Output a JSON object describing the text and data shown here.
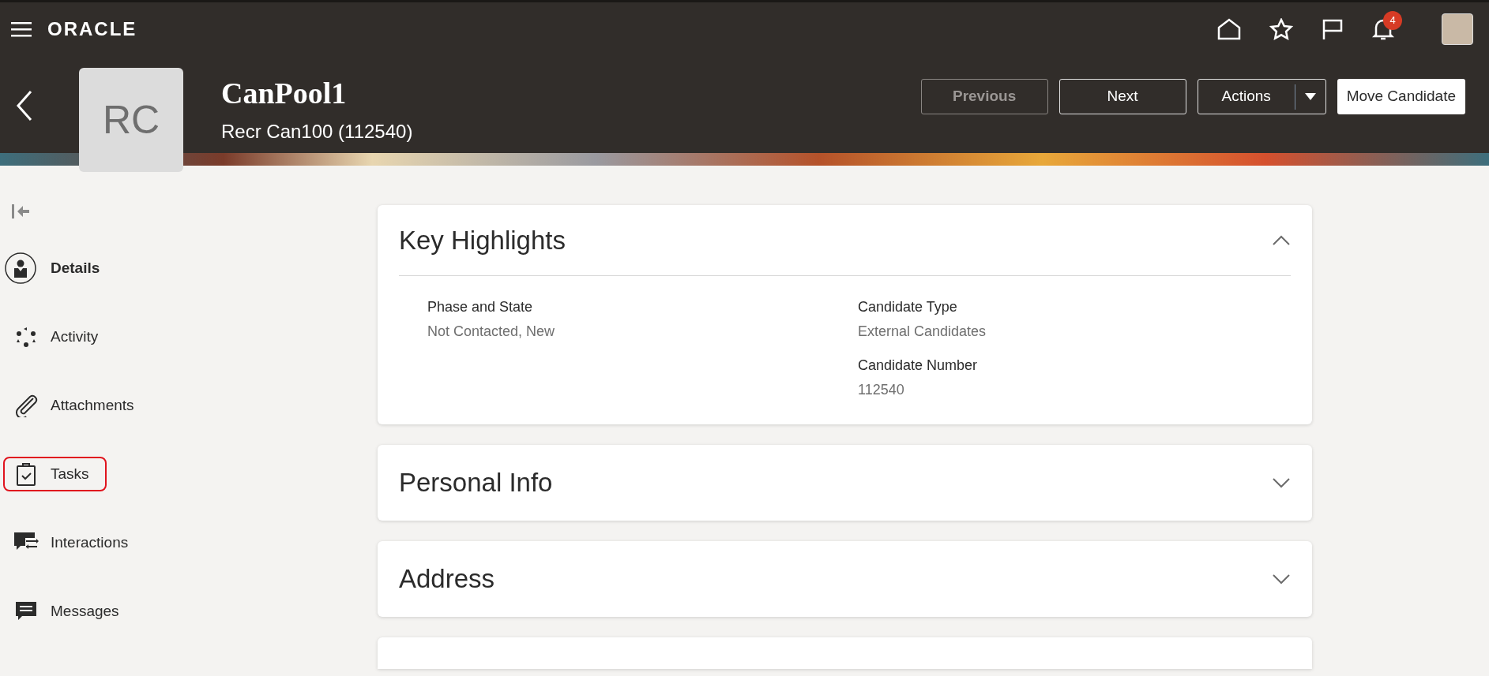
{
  "top_bar": {
    "logo": "ORACLE",
    "notifications_count": "4"
  },
  "header": {
    "avatar_initials": "RC",
    "title": "CanPool1",
    "subtitle": "Recr Can100 (112540)",
    "buttons": [
      {
        "label": "Previous",
        "kind": "plain",
        "disabled": true
      },
      {
        "label": "Next",
        "kind": "plain",
        "disabled": false
      },
      {
        "label": "Actions",
        "kind": "menu"
      },
      {
        "label": "Move Candidate",
        "kind": "primary"
      }
    ]
  },
  "sidebar": {
    "items": [
      {
        "label": "Details",
        "selected": true,
        "highlighted": false
      },
      {
        "label": "Activity",
        "selected": false,
        "highlighted": false
      },
      {
        "label": "Attachments",
        "selected": false,
        "highlighted": false
      },
      {
        "label": "Tasks",
        "selected": false,
        "highlighted": true
      },
      {
        "label": "Interactions",
        "selected": false,
        "highlighted": false
      },
      {
        "label": "Messages",
        "selected": false,
        "highlighted": false
      }
    ]
  },
  "sections": [
    {
      "title": "Key Highlights",
      "expanded": true,
      "columns": [
        [
          {
            "label": "Phase and State",
            "value": "Not Contacted, New"
          }
        ],
        [
          {
            "label": "Candidate Type",
            "value": "External Candidates"
          },
          {
            "label": "Candidate Number",
            "value": "112540"
          }
        ]
      ]
    },
    {
      "title": "Personal Info",
      "expanded": false
    },
    {
      "title": "Address",
      "expanded": false
    }
  ]
}
